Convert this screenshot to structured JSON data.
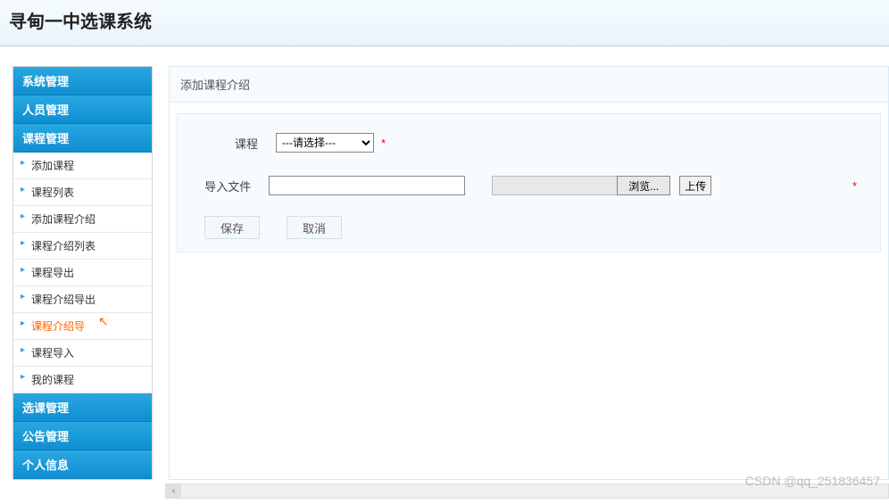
{
  "header": {
    "title": "寻甸一中选课系统"
  },
  "sidebar": {
    "sections": [
      {
        "label": "系统管理",
        "expanded": false
      },
      {
        "label": "人员管理",
        "expanded": false
      },
      {
        "label": "课程管理",
        "expanded": true,
        "items": [
          {
            "label": "添加课程",
            "active": false
          },
          {
            "label": "课程列表",
            "active": false
          },
          {
            "label": "添加课程介绍",
            "active": false
          },
          {
            "label": "课程介绍列表",
            "active": false
          },
          {
            "label": "课程导出",
            "active": false
          },
          {
            "label": "课程介绍导出",
            "active": false
          },
          {
            "label": "课程介绍导",
            "active": true
          },
          {
            "label": "课程导入",
            "active": false
          },
          {
            "label": "我的课程",
            "active": false
          }
        ]
      },
      {
        "label": "选课管理",
        "expanded": false
      },
      {
        "label": "公告管理",
        "expanded": false
      },
      {
        "label": "个人信息",
        "expanded": false
      }
    ]
  },
  "content": {
    "panel_title": "添加课程介绍",
    "form": {
      "course_label": "课程",
      "course_placeholder": "---请选择---",
      "required_marker": "*",
      "import_label": "导入文件",
      "browse_label": "浏览...",
      "upload_label": "上传"
    },
    "actions": {
      "save": "保存",
      "cancel": "取消"
    }
  },
  "watermark": "CSDN @qq_251836457"
}
